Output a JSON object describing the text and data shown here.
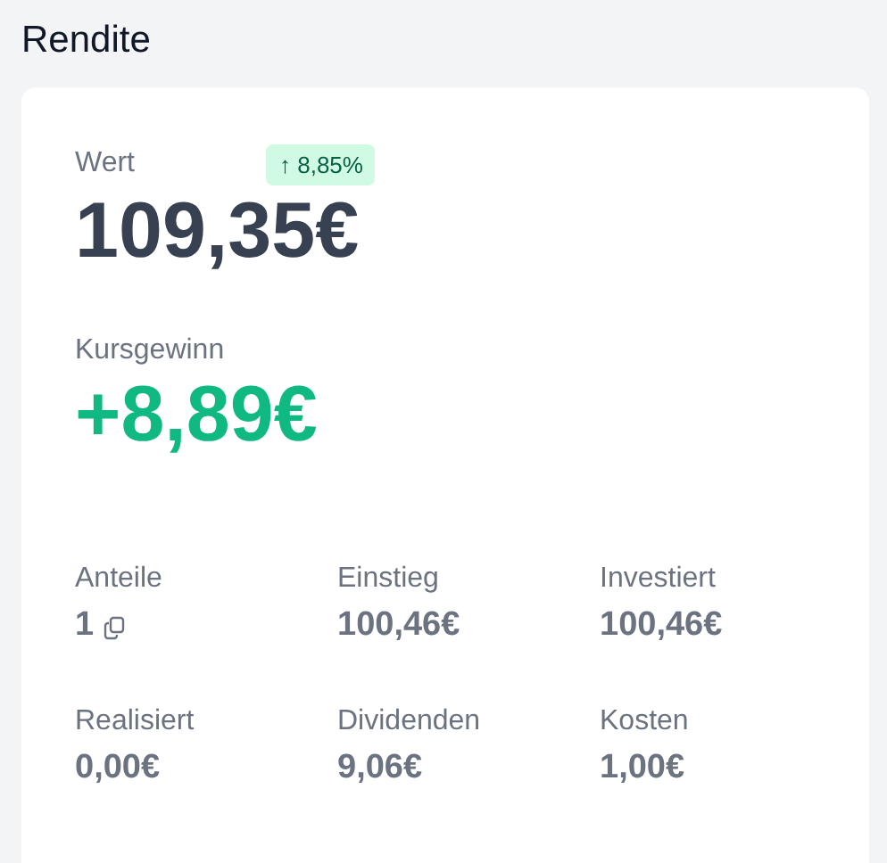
{
  "title": "Rendite",
  "value": {
    "label": "Wert",
    "amount": "109,35€",
    "change": "↑ 8,85%"
  },
  "gain": {
    "label": "Kursgewinn",
    "amount": "+8,89€"
  },
  "stats": [
    {
      "label": "Anteile",
      "value": "1",
      "copy_icon": true
    },
    {
      "label": "Einstieg",
      "value": "100,46€",
      "copy_icon": false
    },
    {
      "label": "Investiert",
      "value": "100,46€",
      "copy_icon": false
    },
    {
      "label": "Realisiert",
      "value": "0,00€",
      "copy_icon": false
    },
    {
      "label": "Dividenden",
      "value": "9,06€",
      "copy_icon": false
    },
    {
      "label": "Kosten",
      "value": "1,00€",
      "copy_icon": false
    }
  ]
}
